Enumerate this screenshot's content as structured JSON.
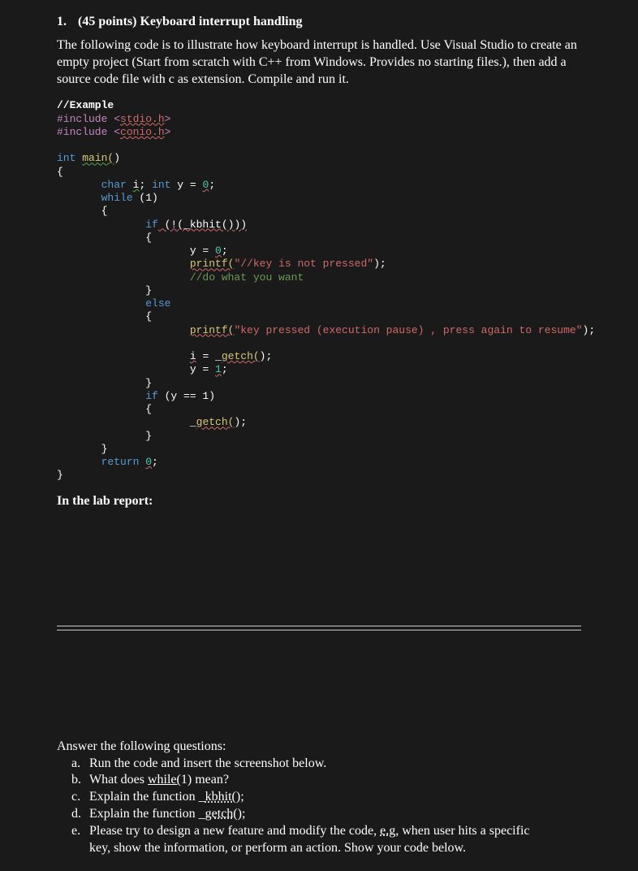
{
  "heading": {
    "number": "1.",
    "points": "(45 points) Keyboard interrupt handling"
  },
  "description": "The following code is to illustrate how keyboard interrupt is handled. Use Visual Studio to create an empty project (Start from scratch with C++ from Windows. Provides no starting files.), then add a source code file with c as extension. Compile and run it.",
  "code": {
    "comment_example": "//Example",
    "include1_pre": "#include <",
    "include1_hdr": "stdio.h",
    "include1_post": ">",
    "include2_pre": "#include <",
    "include2_hdr": "conio.h",
    "include2_post": ">",
    "int_kw": "int",
    "main_fn": "main(",
    "main_close": ")",
    "brace_open": "{",
    "char_kw": "char",
    "var_i": "i",
    "semi": ";",
    "int_kw2": "int",
    "y_eq_0": " y = ",
    "zero_lit": "0",
    "while_kw": "while",
    "one_paren": " (1)",
    "if_kw": "if",
    "not_kbhit": " (!(_kbhit()))",
    "y_eq": "y = ",
    "pf_kw": "printf(",
    "str_nopress": "\"//key is not pressed\"",
    "paren_semi": ");",
    "do_what": "//do what you want",
    "else_kw": "else",
    "str_press": "\"key pressed (execution pause) , press again to resume\"",
    "i_eq": "i",
    "eq_getch": " = _",
    "getch_fn": "getch(",
    "getch_close": ")",
    "y_eq_1": "y = ",
    "one_lit": "1",
    "if_y1": " (y == 1)",
    "getch_pre": "_",
    "return_kw": "return",
    "brace_close": "}"
  },
  "lab_report": "In the lab report:",
  "questions_intro": "Answer the following questions:",
  "questions": {
    "a": {
      "letter": "a.",
      "text": "Run the code and insert the screenshot below."
    },
    "b": {
      "letter": "b.",
      "pre": "What does ",
      "mid": "while(",
      "post": "1) mean?"
    },
    "c": {
      "letter": "c.",
      "pre": "Explain the function ",
      "fn_pre": "_",
      "fn": "kbhit(",
      "fn_post": ");"
    },
    "d": {
      "letter": "d.",
      "pre": "Explain the function ",
      "fn_pre": "_",
      "fn": "getch(",
      "fn_post": ");"
    },
    "e": {
      "letter": "e.",
      "line1_pre": "Please try to design a new feature and modify the code, ",
      "eg": "e.g",
      "line1_post": ", when user hits a specific",
      "line2": "key, show the information, or perform an action. Show your code below."
    }
  }
}
